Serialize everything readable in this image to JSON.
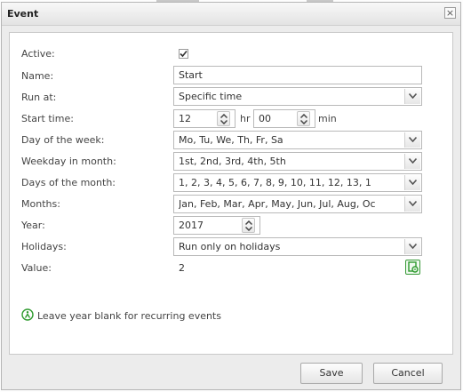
{
  "dialog": {
    "title": "Event"
  },
  "form": {
    "active": {
      "label": "Active:",
      "checked": true
    },
    "name": {
      "label": "Name:",
      "value": "Start"
    },
    "run_at": {
      "label": "Run at:",
      "value": "Specific time"
    },
    "start_time": {
      "label": "Start time:",
      "hour": "12",
      "hour_unit": "hr",
      "minute": "00",
      "minute_unit": "min"
    },
    "day_of_week": {
      "label": "Day of the week:",
      "value": "Mo, Tu, We, Th, Fr, Sa"
    },
    "weekday_in_month": {
      "label": "Weekday in month:",
      "value": "1st, 2nd, 3rd, 4th, 5th"
    },
    "days_of_month": {
      "label": "Days of the month:",
      "value": "1, 2, 3, 4, 5, 6, 7, 8, 9, 10, 11, 12, 13, 1"
    },
    "months": {
      "label": "Months:",
      "value": "Jan, Feb, Mar, Apr, May, Jun, Jul, Aug, Oc"
    },
    "year": {
      "label": "Year:",
      "value": "2017"
    },
    "holidays": {
      "label": "Holidays:",
      "value": "Run only on holidays"
    },
    "value": {
      "label": "Value:",
      "value": "2"
    }
  },
  "hint": {
    "text": "Leave year blank for recurring events",
    "icon": "info-person-icon"
  },
  "buttons": {
    "save": "Save",
    "cancel": "Cancel"
  },
  "colors": {
    "accent_green": "#2e9a2e",
    "border": "#b9b9b9"
  }
}
